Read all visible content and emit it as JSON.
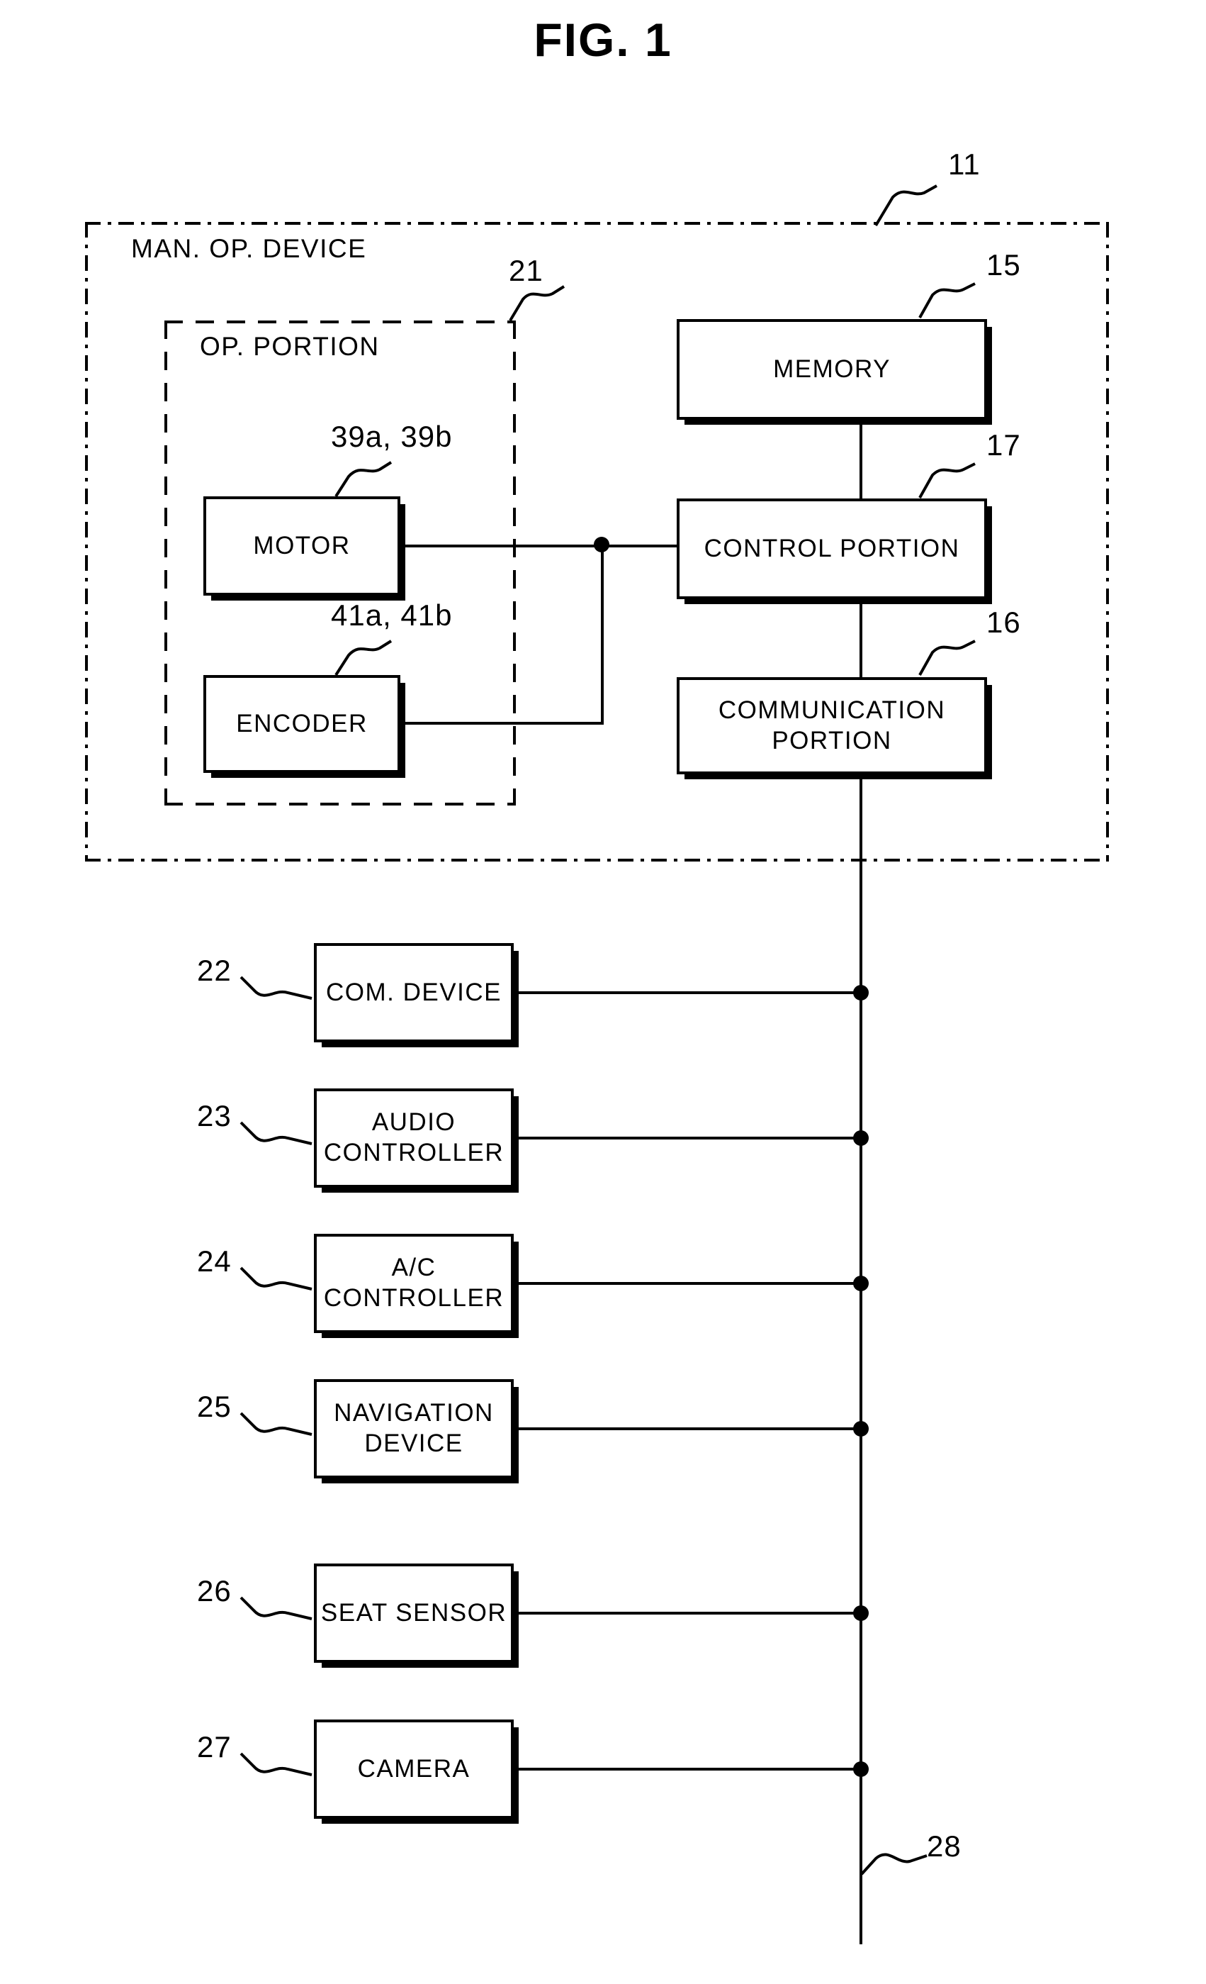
{
  "figure": {
    "title": "FIG. 1",
    "outer_enclosure_label": "MAN. OP. DEVICE",
    "outer_enclosure_ref": "11",
    "inner_enclosure_label": "OP. PORTION",
    "inner_enclosure_ref": "21",
    "bus_ref": "28"
  },
  "blocks": {
    "memory": {
      "label": "MEMORY",
      "ref": "15"
    },
    "control_portion": {
      "label": "CONTROL PORTION",
      "ref": "17"
    },
    "communication_portion": {
      "label": "COMMUNICATION\nPORTION",
      "line1": "COMMUNICATION",
      "line2": "PORTION",
      "ref": "16"
    },
    "motor": {
      "label": "MOTOR",
      "ref": "39a, 39b"
    },
    "encoder": {
      "label": "ENCODER",
      "ref": "41a, 41b"
    }
  },
  "peripherals": [
    {
      "label": "COM. DEVICE",
      "ref": "22"
    },
    {
      "label": "AUDIO CONTROLLER",
      "ref": "23"
    },
    {
      "label": "A/C CONTROLLER",
      "ref": "24"
    },
    {
      "label": "NAVIGATION DEVICE",
      "ref": "25"
    },
    {
      "label": "SEAT SENSOR",
      "ref": "26"
    },
    {
      "label": "CAMERA",
      "ref": "27"
    }
  ]
}
